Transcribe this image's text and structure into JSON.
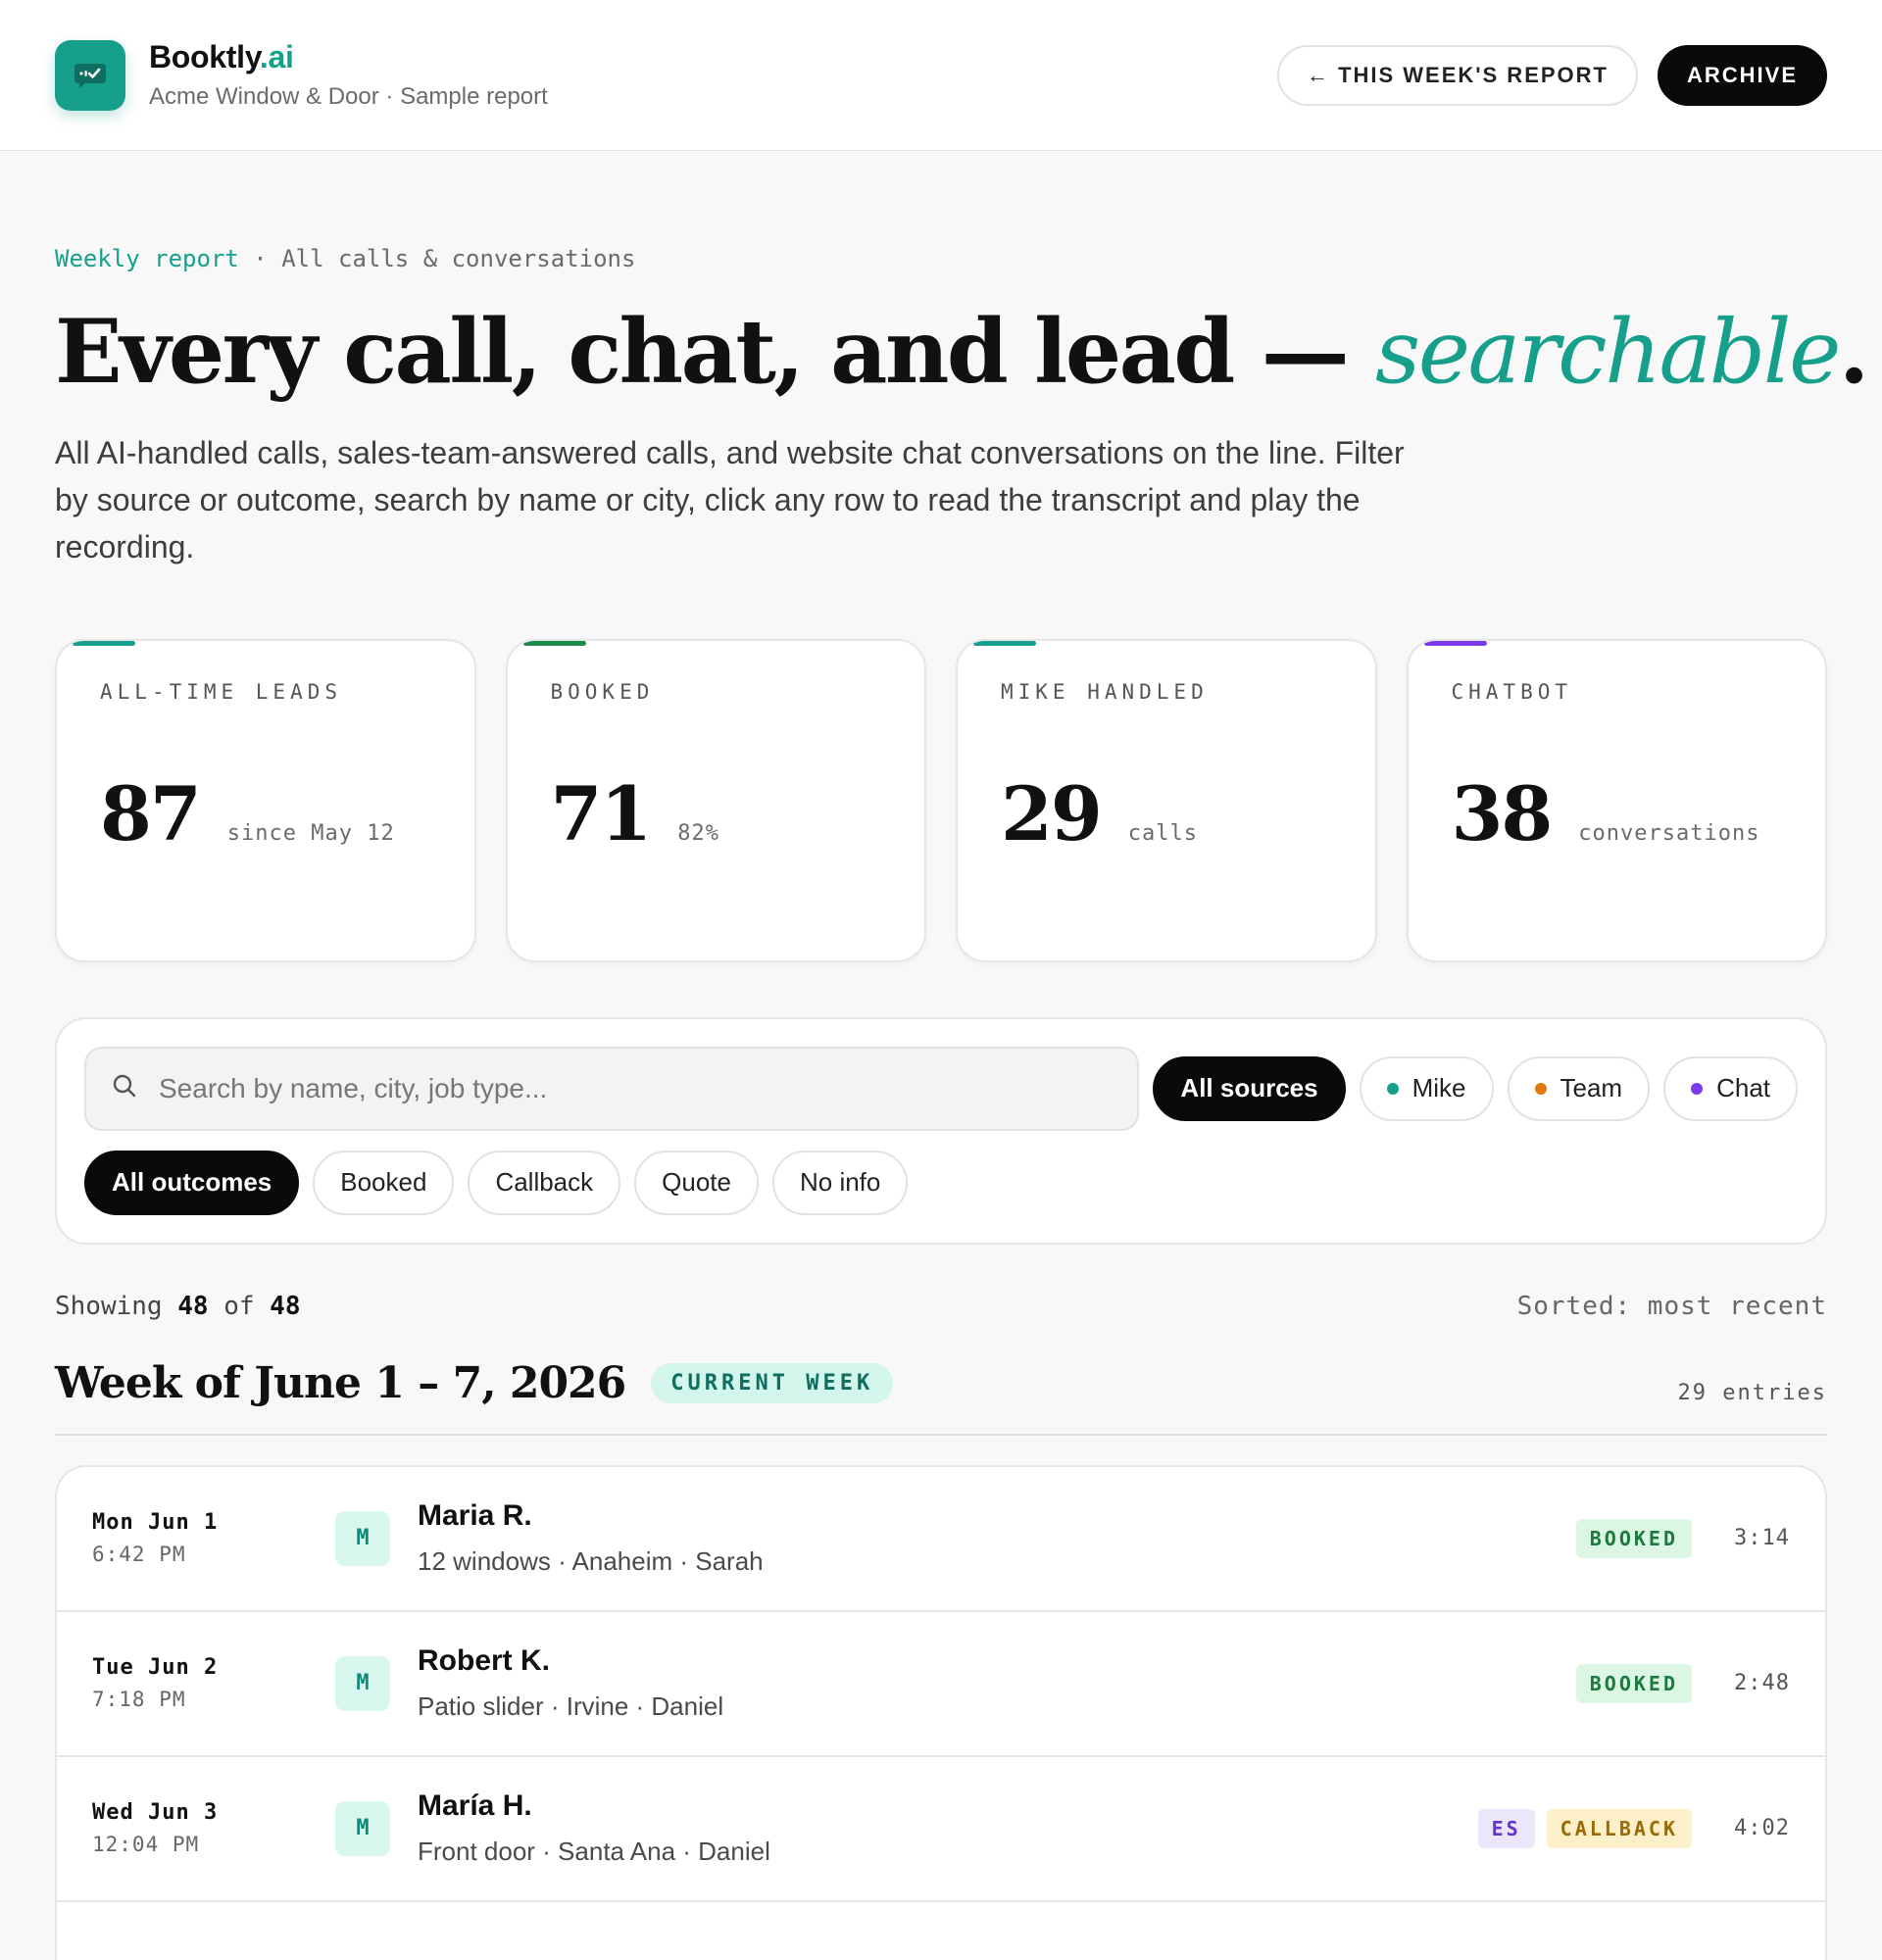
{
  "header": {
    "brand_name": "Booktly",
    "brand_suffix": ".ai",
    "subtitle": "Acme Window & Door · Sample report",
    "report_button": "← THIS WEEK'S REPORT",
    "archive_button": "ARCHIVE"
  },
  "eyebrow": {
    "primary": "Weekly report",
    "separator": " · ",
    "secondary": "All calls & conversations"
  },
  "headline": {
    "main": "Every call, chat, and lead — ",
    "accent": "searchable",
    "end": "."
  },
  "intro": "All AI-handled calls, sales-team-answered calls, and website chat conversations on the line. Filter by source or outcome, search by name or city, click any row to read the transcript and play the recording.",
  "stats": [
    {
      "label": "ALL-TIME LEADS",
      "value": "87",
      "sub": "since May 12",
      "color": "#16a08c"
    },
    {
      "label": "BOOKED",
      "value": "71",
      "sub": "82%",
      "color": "#1d8a4a"
    },
    {
      "label": "MIKE HANDLED",
      "value": "29",
      "sub": "calls",
      "color": "#16a08c"
    },
    {
      "label": "CHATBOT",
      "value": "38",
      "sub": "conversations",
      "color": "#7c3aed"
    }
  ],
  "search": {
    "placeholder": "Search by name, city, job type..."
  },
  "sources": [
    {
      "label": "All sources",
      "active": true
    },
    {
      "label": "Mike",
      "dot": "#16a08c"
    },
    {
      "label": "Team",
      "dot": "#e07a10"
    },
    {
      "label": "Chat",
      "dot": "#7c3aed"
    }
  ],
  "outcomes": [
    {
      "label": "All outcomes",
      "active": true
    },
    {
      "label": "Booked"
    },
    {
      "label": "Callback"
    },
    {
      "label": "Quote"
    },
    {
      "label": "No info"
    }
  ],
  "list_meta": {
    "showing_prefix": "Showing",
    "shown": "48",
    "of": "of",
    "total": "48",
    "sorted": "Sorted: most recent"
  },
  "week": {
    "title": "Week of June 1 – 7, 2026",
    "badge": "CURRENT WEEK",
    "count": "29 entries"
  },
  "entries": [
    {
      "day": "Mon Jun 1",
      "time": "6:42 PM",
      "avatar": "M",
      "name": "Maria R.",
      "detail": "12 windows · Anaheim · Sarah",
      "lang": "",
      "outcome": "BOOKED",
      "duration": "3:14"
    },
    {
      "day": "Tue Jun 2",
      "time": "7:18 PM",
      "avatar": "M",
      "name": "Robert K.",
      "detail": "Patio slider · Irvine · Daniel",
      "lang": "",
      "outcome": "BOOKED",
      "duration": "2:48"
    },
    {
      "day": "Wed Jun 3",
      "time": "12:04 PM",
      "avatar": "M",
      "name": "María H.",
      "detail": "Front door · Santa Ana · Daniel",
      "lang": "ES",
      "outcome": "CALLBACK",
      "duration": "4:02"
    }
  ]
}
